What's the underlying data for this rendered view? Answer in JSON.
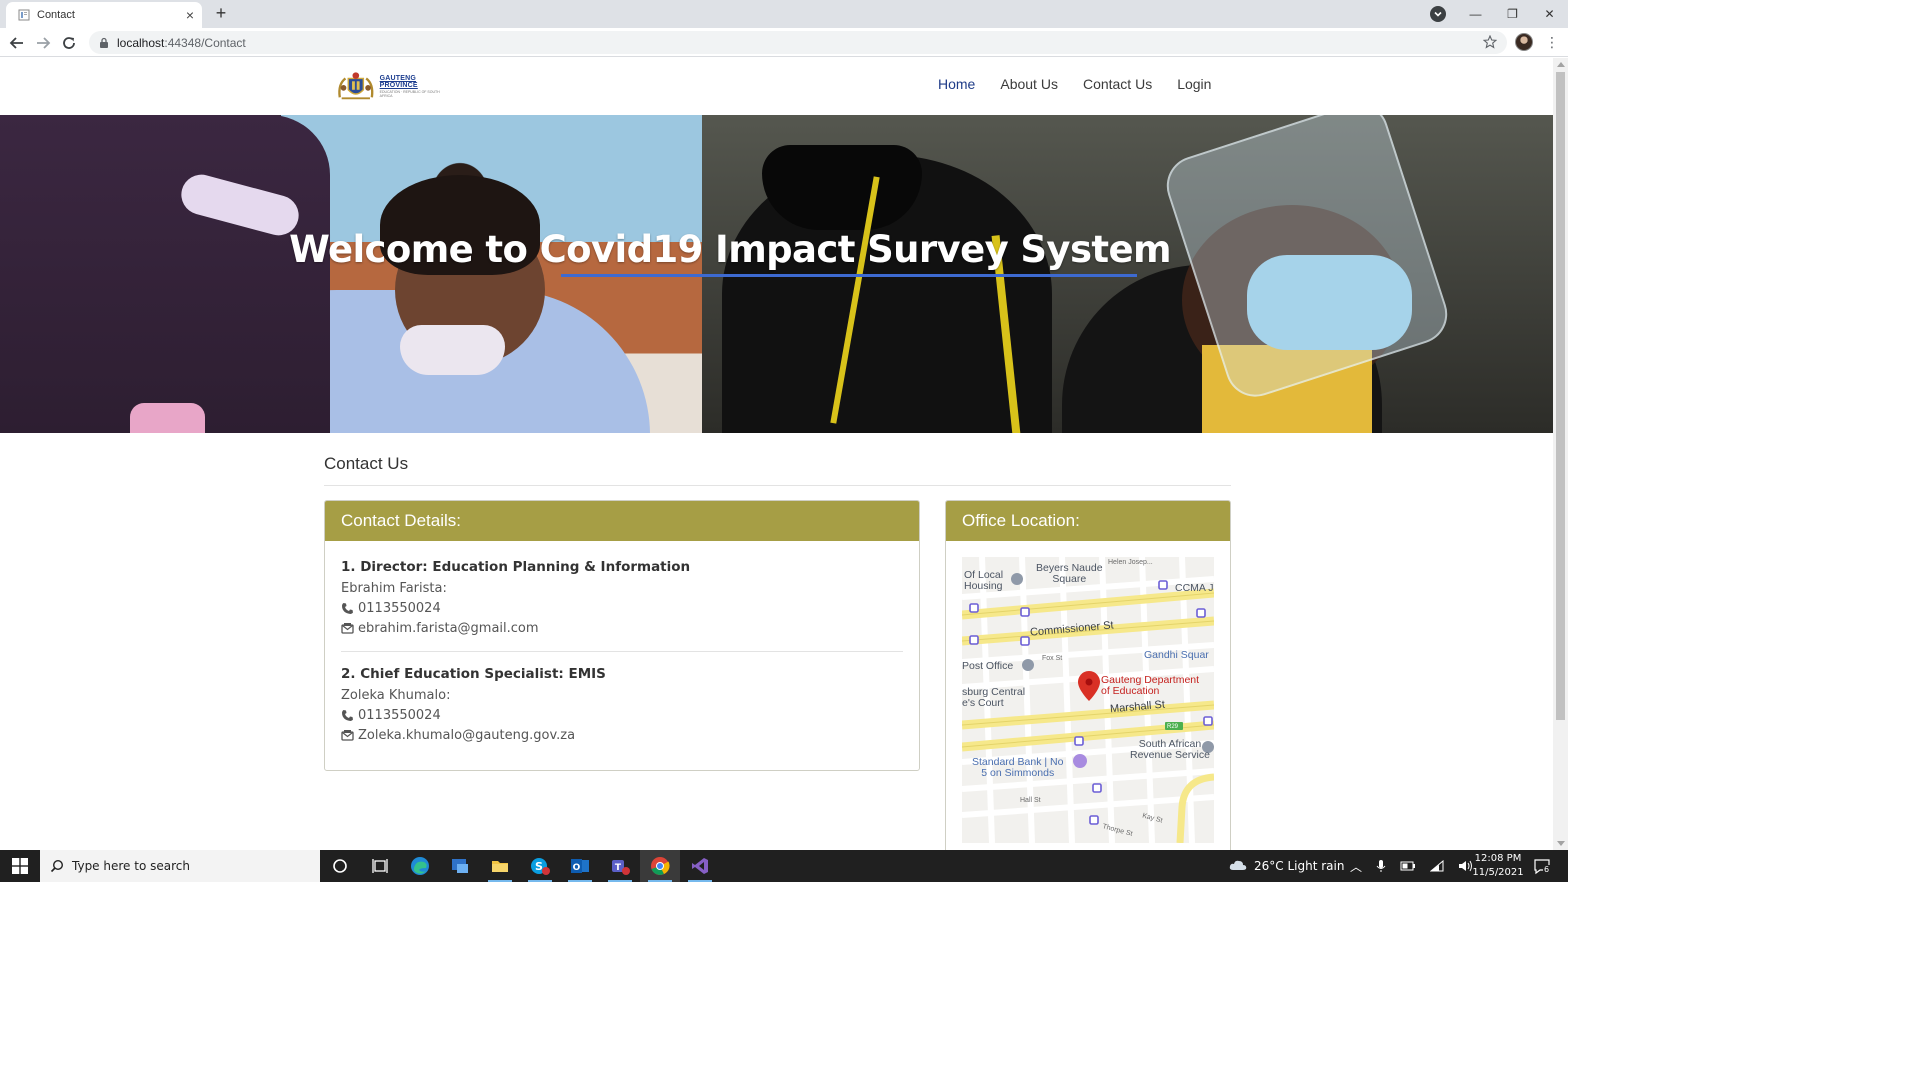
{
  "browser": {
    "tab_title": "Contact",
    "url_host": "localhost",
    "url_path": ":44348/Contact"
  },
  "nav": {
    "logo_line1": "GAUTENG PROVINCE",
    "logo_line2": "EDUCATION · REPUBLIC OF SOUTH AFRICA",
    "items": [
      {
        "label": "Home",
        "active": true
      },
      {
        "label": "About Us",
        "active": false
      },
      {
        "label": "Contact Us",
        "active": false
      },
      {
        "label": "Login",
        "active": false
      }
    ]
  },
  "hero": {
    "title": "Welcome to Covid19 Impact Survey System"
  },
  "page": {
    "heading": "Contact Us"
  },
  "contact_panel": {
    "title": "Contact Details:",
    "contacts": [
      {
        "title": "1. Director: Education Planning & Information",
        "name": "Ebrahim Farista:",
        "phone": "0113550024",
        "email": "ebrahim.farista@gmail.com"
      },
      {
        "title": "2. Chief Education Specialist: EMIS",
        "name": "Zoleka Khumalo:",
        "phone": "0113550024",
        "email": "Zoleka.khumalo@gauteng.gov.za"
      }
    ]
  },
  "office_panel": {
    "title": "Office Location:",
    "map_labels": {
      "local_housing": "Of Local\nHousing",
      "beyers": "Beyers Naude\nSquare",
      "helen": "Helen Josep...",
      "ccma": "CCMA J",
      "commissioner": "Commissioner St",
      "fox": "Fox St",
      "post_office": "Post Office",
      "gandhi": "Gandhi Squar",
      "gauteng_dept": "Gauteng Department\nof Education",
      "burg_central": "sburg Central\ne's Court",
      "marshall": "Marshall St",
      "r29": "R29",
      "sars": "South African\nRevenue Service",
      "standard_bank": "Standard Bank | No\n5 on Simmonds",
      "hall": "Hall St",
      "kay": "Kay St",
      "thorpe": "Thorpe St"
    }
  },
  "taskbar": {
    "search_placeholder": "Type here to search",
    "weather": "26°C  Light rain",
    "time": "12:08 PM",
    "date": "11/5/2021",
    "notification_count": "6"
  },
  "colors": {
    "panel_header": "#a69e45",
    "nav_active": "#1f3c88",
    "hero_underline": "#3d6ad1"
  }
}
